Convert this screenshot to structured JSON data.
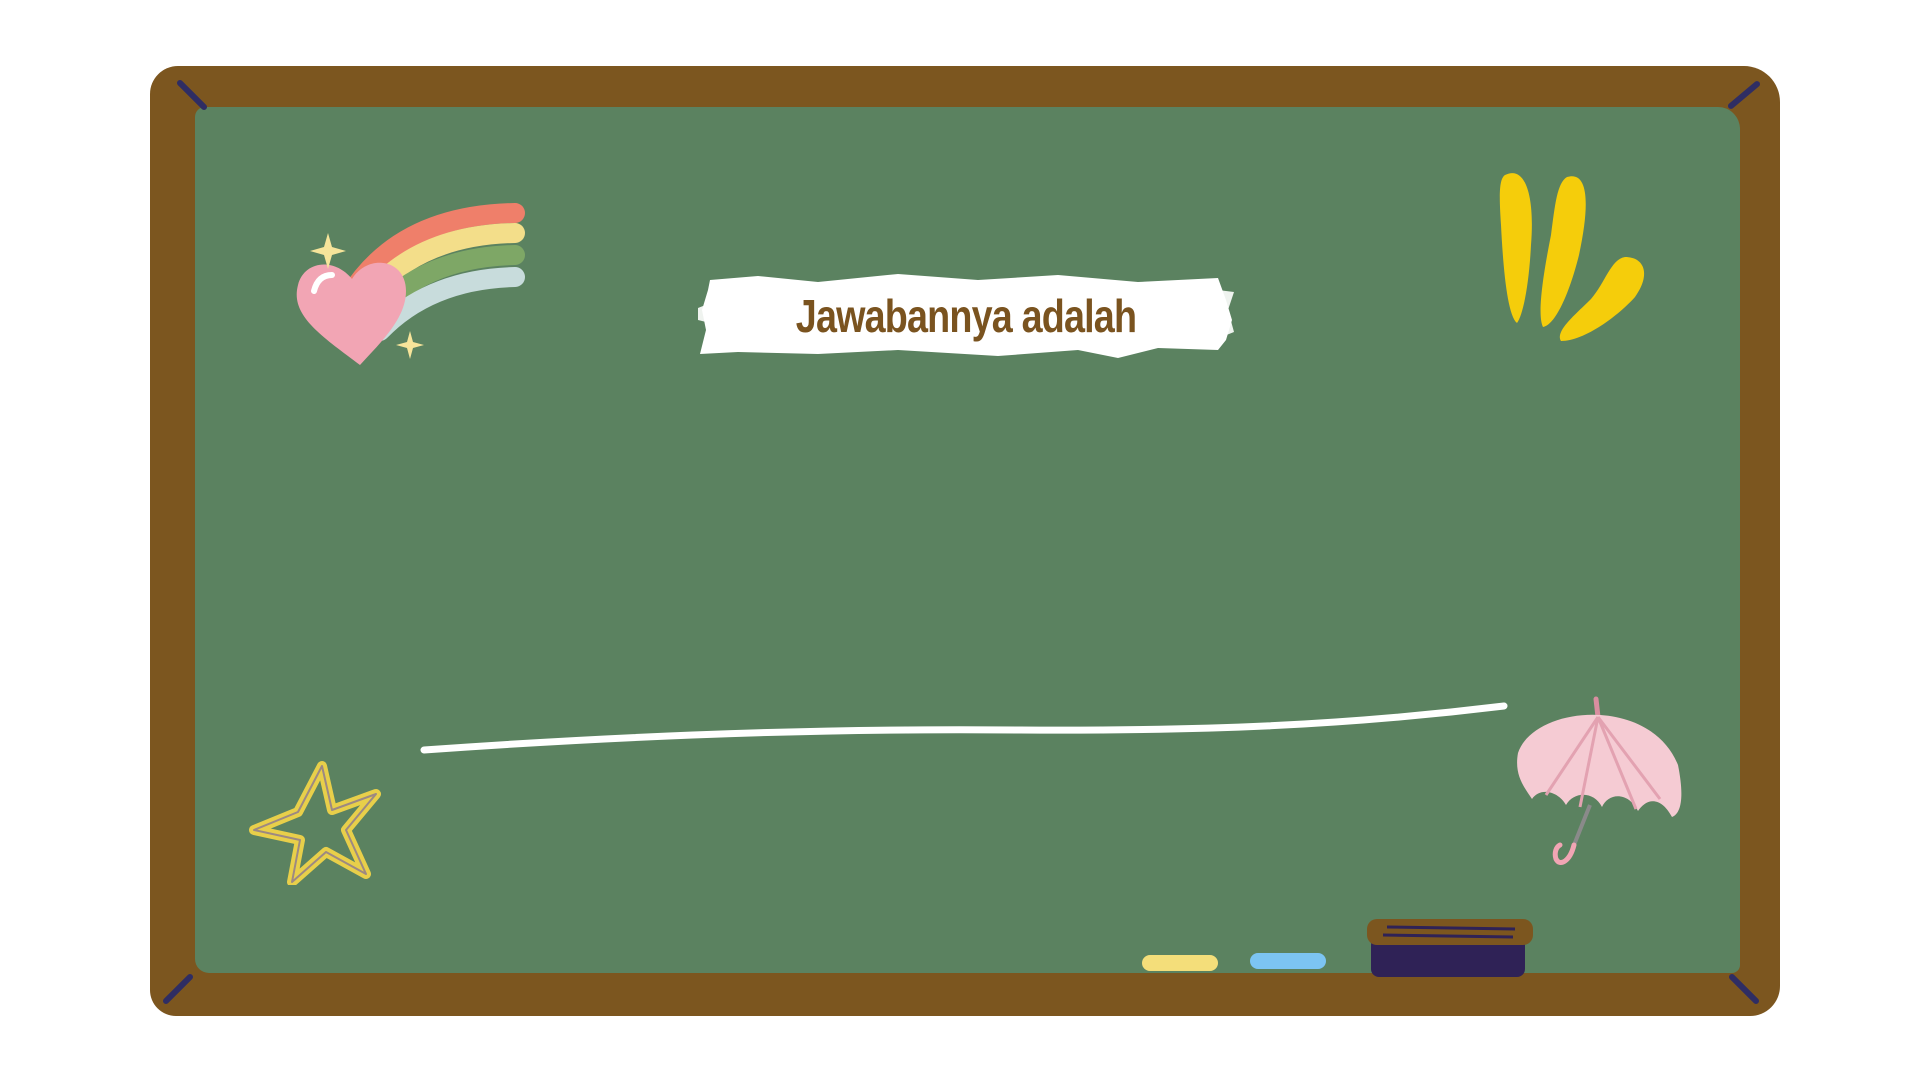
{
  "title": {
    "text": "Jawabannya adalah"
  },
  "colors": {
    "frame": "#7c561f",
    "board": "#5b8260",
    "title_text": "#7a531f",
    "chalk_white": "#ffffff",
    "chalk_yellow": "#f4de7a",
    "chalk_blue": "#7cc4f2",
    "eraser_body": "#2f2256",
    "eraser_top": "#7c561f"
  },
  "decorations": {
    "rainbow_heart": "rainbow-heart-icon",
    "yellow_strokes": "yellow-brush-strokes-icon",
    "star": "star-doodle-icon",
    "umbrella": "umbrella-icon",
    "chalks": [
      "yellow-chalk-icon",
      "blue-chalk-icon"
    ],
    "eraser": "eraser-icon"
  }
}
